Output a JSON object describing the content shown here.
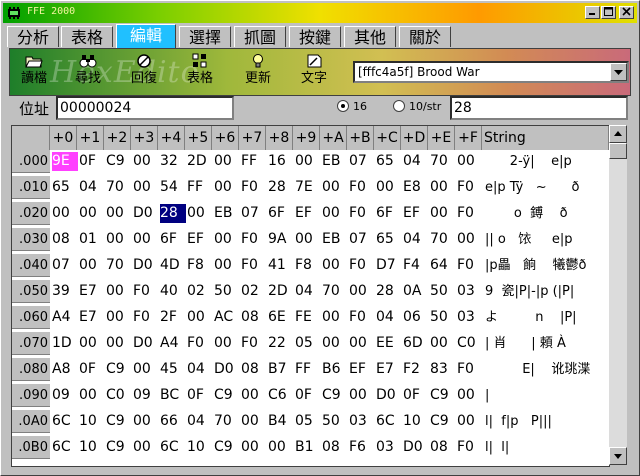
{
  "window": {
    "title": "FFE 2000"
  },
  "tabs": [
    "分析",
    "表格",
    "編輯",
    "選擇",
    "抓圖",
    "按鍵",
    "其他",
    "關於"
  ],
  "active_tab": "編輯",
  "toolbar": {
    "watermark": "HexEdito",
    "buttons": [
      {
        "label": "讀檔",
        "icon": "open-folder-icon"
      },
      {
        "label": "尋找",
        "icon": "binoculars-icon"
      },
      {
        "label": "回復",
        "icon": "undo-icon"
      },
      {
        "label": "表格",
        "icon": "table-icon"
      },
      {
        "label": "更新",
        "icon": "lightbulb-icon"
      },
      {
        "label": "文字",
        "icon": "text-pen-icon"
      }
    ],
    "profile_select": "[fffc4a5f] Brood War"
  },
  "address": {
    "label": "位址",
    "value": "00000024"
  },
  "mode": {
    "hex_label": "16",
    "str_label": "10/str",
    "selected": "16",
    "value": "28"
  },
  "grid": {
    "col_headers": [
      "+0",
      "+1",
      "+2",
      "+3",
      "+4",
      "+5",
      "+6",
      "+7",
      "+8",
      "+9",
      "+A",
      "+B",
      "+C",
      "+D",
      "+E",
      "+F",
      "String"
    ],
    "rows": [
      {
        "addr": ".000",
        "bytes": [
          "9E",
          "0F",
          "C9",
          "00",
          "32",
          "2D",
          "00",
          "FF",
          "16",
          "00",
          "EB",
          "07",
          "65",
          "04",
          "70",
          "00"
        ],
        "str": "      2-ÿ|    e|p"
      },
      {
        "addr": ".010",
        "bytes": [
          "65",
          "04",
          "70",
          "00",
          "54",
          "FF",
          "00",
          "F0",
          "28",
          "7E",
          "00",
          "F0",
          "00",
          "E8",
          "00",
          "F0"
        ],
        "str": "e|p Tÿ   ~      ð"
      },
      {
        "addr": ".020",
        "bytes": [
          "00",
          "00",
          "00",
          "D0",
          "28",
          "00",
          "EB",
          "07",
          "6F",
          "EF",
          "00",
          "F0",
          "6F",
          "EF",
          "00",
          "F0"
        ],
        "str": "       o  鎛    ð"
      },
      {
        "addr": ".030",
        "bytes": [
          "08",
          "01",
          "00",
          "00",
          "6F",
          "EF",
          "00",
          "F0",
          "9A",
          "00",
          "EB",
          "07",
          "65",
          "04",
          "70",
          "00"
        ],
        "str": "|| o   饻     e|p"
      },
      {
        "addr": ".040",
        "bytes": [
          "07",
          "00",
          "70",
          "D0",
          "4D",
          "F8",
          "00",
          "F0",
          "41",
          "F8",
          "00",
          "F0",
          "D7",
          "F4",
          "64",
          "F0"
        ],
        "str": "|p畾   餉    犧鬱ð"
      },
      {
        "addr": ".050",
        "bytes": [
          "39",
          "E7",
          "00",
          "F0",
          "40",
          "02",
          "50",
          "02",
          "2D",
          "04",
          "70",
          "00",
          "28",
          "0A",
          "50",
          "03"
        ],
        "str": "9  瓷|P|-|p (|P|"
      },
      {
        "addr": ".060",
        "bytes": [
          "A4",
          "E7",
          "00",
          "F0",
          "2F",
          "00",
          "AC",
          "08",
          "6E",
          "FE",
          "00",
          "F0",
          "04",
          "06",
          "50",
          "03"
        ],
        "str": "よ         n    |P|"
      },
      {
        "addr": ".070",
        "bytes": [
          "1D",
          "00",
          "00",
          "D0",
          "A4",
          "F0",
          "00",
          "F0",
          "22",
          "05",
          "00",
          "00",
          "EE",
          "6D",
          "00",
          "C0"
        ],
        "str": "| 肖      | 頼 À"
      },
      {
        "addr": ".080",
        "bytes": [
          "A8",
          "0F",
          "C9",
          "00",
          "45",
          "04",
          "D0",
          "08",
          "B7",
          "FF",
          "B6",
          "EF",
          "E7",
          "F2",
          "83",
          "F0"
        ],
        "str": "         E|    讹珧渫"
      },
      {
        "addr": ".090",
        "bytes": [
          "09",
          "00",
          "C0",
          "09",
          "BC",
          "0F",
          "C9",
          "00",
          "C6",
          "0F",
          "C9",
          "00",
          "D0",
          "0F",
          "C9",
          "00"
        ],
        "str": "|"
      },
      {
        "addr": ".0A0",
        "bytes": [
          "6C",
          "10",
          "C9",
          "00",
          "66",
          "04",
          "70",
          "00",
          "B4",
          "05",
          "50",
          "03",
          "6C",
          "10",
          "C9",
          "00"
        ],
        "str": "l|  f|p   P|||"
      },
      {
        "addr": ".0B0",
        "bytes": [
          "6C",
          "10",
          "C9",
          "00",
          "6C",
          "10",
          "C9",
          "00",
          "00",
          "B1",
          "08",
          "F6",
          "03",
          "D0",
          "08",
          "F0"
        ],
        "str": "l|  l|"
      }
    ],
    "highlight_magenta": {
      "row": 0,
      "col": 0
    },
    "highlight_cursor": {
      "row": 2,
      "col": 4
    }
  }
}
